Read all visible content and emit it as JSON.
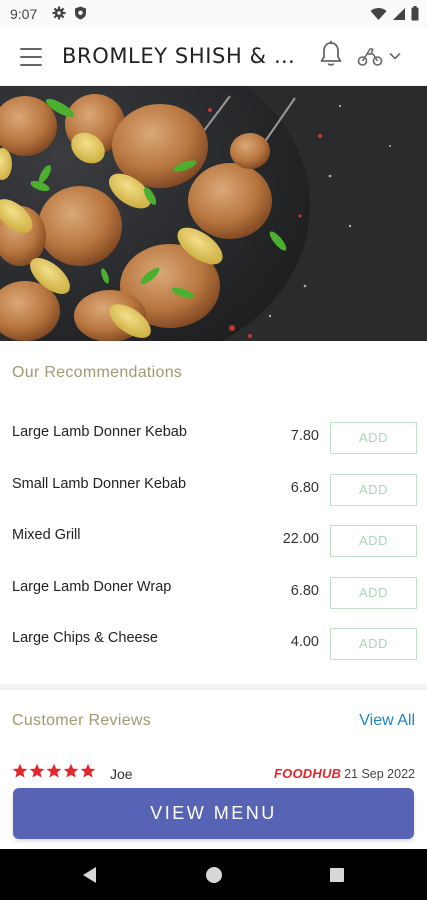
{
  "status_bar": {
    "time": "9:07",
    "left_icons": [
      "gear-icon",
      "shield-icon"
    ],
    "right_icons": [
      "wifi-icon",
      "signal-icon",
      "battery-icon"
    ]
  },
  "app_bar": {
    "title": "BROMLEY SHISH & G...",
    "icons": [
      "menu-icon",
      "bell-icon",
      "ride-icon",
      "chevron-down-icon"
    ]
  },
  "recommendations": {
    "title": "Our Recommendations",
    "items": [
      {
        "name": "Large Lamb Donner Kebab",
        "price": "7.80",
        "button": "ADD"
      },
      {
        "name": "Small Lamb Donner Kebab",
        "price": "6.80",
        "button": "ADD"
      },
      {
        "name": "Mixed Grill",
        "price": "22.00",
        "button": "ADD"
      },
      {
        "name": "Large Lamb Doner Wrap",
        "price": "6.80",
        "button": "ADD"
      },
      {
        "name": "Large Chips & Cheese",
        "price": "4.00",
        "button": "ADD"
      }
    ]
  },
  "reviews": {
    "title": "Customer Reviews",
    "view_all": "View All",
    "first_review": {
      "rating": 5,
      "max_rating": 5,
      "reviewer": "Joe",
      "source": "FOODHUB",
      "date": "21 Sep 2022"
    }
  },
  "view_menu": {
    "label": "VIEW MENU"
  },
  "colors": {
    "accent": "#5764b5",
    "section_title": "#a09870",
    "link": "#1c83c5",
    "star": "#e3272d",
    "add_border": "#bfe0cb"
  }
}
